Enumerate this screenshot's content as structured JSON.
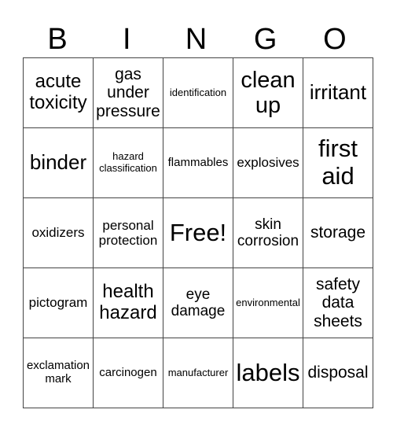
{
  "header": {
    "letters": [
      "B",
      "I",
      "N",
      "G",
      "O"
    ]
  },
  "grid": {
    "rows": [
      [
        "acute toxicity",
        "gas under pressure",
        "identification",
        "clean up",
        "irritant"
      ],
      [
        "binder",
        "hazard classification",
        "flammables",
        "explosives",
        "first aid"
      ],
      [
        "oxidizers",
        "personal protection",
        "Free!",
        "skin corrosion",
        "storage"
      ],
      [
        "pictogram",
        "health hazard",
        "eye damage",
        "environmental",
        "safety data sheets"
      ],
      [
        "exclamation mark",
        "carcinogen",
        "manufacturer",
        "labels",
        "disposal"
      ]
    ]
  }
}
